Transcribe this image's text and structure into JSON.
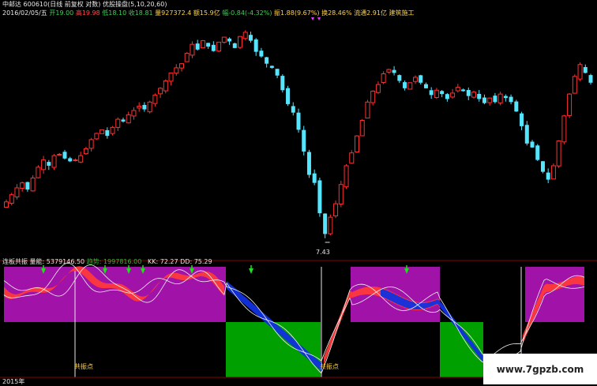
{
  "header": {
    "app": "中邮达",
    "code": "600610",
    "desc": "(日线 前复权 对数)",
    "indicator": "优股操盘(5,10,20,60)",
    "date": "2016/02/05/五",
    "open_label": "开",
    "open": "19.00",
    "high_label": "高",
    "high": "19.98",
    "low_label": "低",
    "low": "18.10",
    "close_label": "收",
    "close": "18.81",
    "volume_label": "量",
    "volume": "927372.4",
    "amount_label": "额",
    "amount": "15.9亿",
    "change_label": "幅",
    "change": "-0.84(-4.32%)",
    "amp_label": "振",
    "amp": "1.88(9.67%)",
    "turnover_label": "换",
    "turnover": "28.46%",
    "float_label": "流通",
    "float": "2.91亿",
    "sector": "建筑施工"
  },
  "price_marks": {
    "low_price": "7.43"
  },
  "sub": {
    "name": "连板共振",
    "vol_label": "量能:",
    "vol": "5379146.50",
    "trend_label": "趋势:",
    "trend": "1997816.00",
    "kk_label": "KK:",
    "kk": "72.27",
    "dd_label": "DD:",
    "dd": "75.29",
    "signal_label": "共振点"
  },
  "xaxis": {
    "first_label": "2015年"
  },
  "watermark": "www.7gpzb.com",
  "colors": {
    "up": "#ff3030",
    "down": "#55e5ff",
    "zone_purple": "#a012a8",
    "zone_green": "#00a000",
    "ribbon_red": "#ff3a3a",
    "ribbon_blue": "#1030e0"
  },
  "chart_data": {
    "type": "candlestick",
    "closes": [
      9.4,
      9.8,
      10.2,
      10.5,
      10.1,
      10.8,
      11.5,
      12.0,
      11.6,
      12.3,
      12.4,
      12.1,
      11.9,
      12.0,
      12.3,
      12.8,
      13.5,
      14.0,
      14.3,
      13.8,
      14.5,
      15.2,
      15.0,
      15.6,
      16.0,
      16.4,
      16.1,
      16.8,
      17.5,
      18.2,
      19.0,
      19.9,
      20.5,
      21.0,
      22.3,
      23.5,
      22.8,
      24.0,
      23.2,
      22.6,
      23.8,
      24.5,
      23.9,
      23.0,
      24.6,
      25.2,
      24.0,
      22.5,
      21.9,
      21.0,
      20.5,
      19.6,
      18.0,
      16.6,
      15.8,
      14.3,
      12.6,
      11.0,
      10.5,
      8.8,
      7.8,
      8.6,
      9.3,
      10.4,
      11.6,
      12.5,
      13.8,
      15.1,
      16.8,
      17.9,
      18.6,
      19.8,
      20.3,
      19.9,
      19.0,
      18.2,
      18.8,
      19.4,
      18.8,
      18.2,
      17.5,
      18.0,
      17.6,
      17.1,
      17.7,
      18.3,
      17.9,
      17.4,
      17.8,
      17.1,
      16.7,
      17.2,
      16.8,
      17.6,
      17.2,
      16.8,
      15.9,
      14.6,
      13.2,
      12.9,
      12.0,
      11.2,
      10.7,
      11.6,
      13.4,
      15.5,
      17.6,
      19.5,
      20.9,
      19.9,
      18.8
    ],
    "low_price": 7.43
  }
}
